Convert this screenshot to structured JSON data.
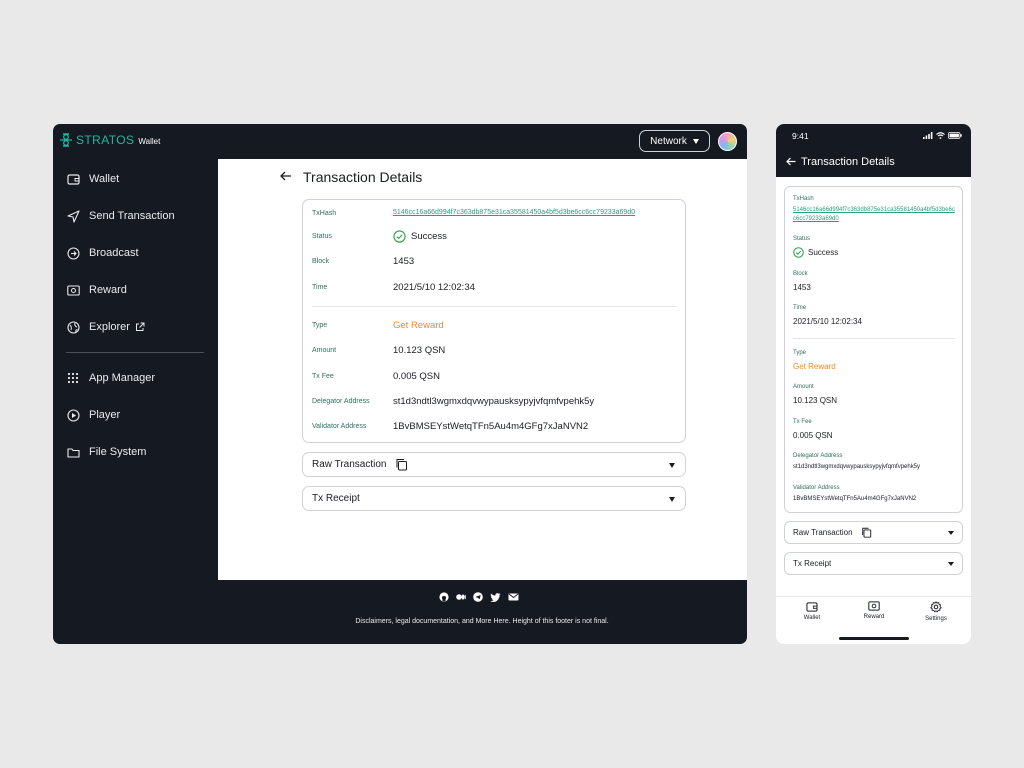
{
  "desktop": {
    "brand": {
      "name": "STRATOS",
      "sub": "Wallet"
    },
    "network_label": "Network",
    "sidebar": {
      "items": [
        {
          "label": "Wallet",
          "icon": "wallet-icon"
        },
        {
          "label": "Send Transaction",
          "icon": "send-icon"
        },
        {
          "label": "Broadcast",
          "icon": "broadcast-icon"
        },
        {
          "label": "Reward",
          "icon": "reward-icon"
        },
        {
          "label": "Explorer",
          "icon": "globe-icon"
        },
        {
          "label": "App Manager",
          "icon": "grid-icon"
        },
        {
          "label": "Player",
          "icon": "play-icon"
        },
        {
          "label": "File System",
          "icon": "folder-icon"
        }
      ]
    },
    "title": "Transaction Details",
    "details": {
      "txhash_label": "TxHash",
      "txhash": "5146cc16a66d994f7c363db875e31ca35581450a4bf5d3be6cc6cc79233a69d0",
      "status_label": "Status",
      "status": "Success",
      "block_label": "Block",
      "block": "1453",
      "time_label": "Time",
      "time": "2021/5/10 12:02:34",
      "type_label": "Type",
      "type": "Get Reward",
      "amount_label": "Amount",
      "amount": "10.123 QSN",
      "fee_label": "Tx Fee",
      "fee": "0.005 QSN",
      "delegator_label": "Delegator Address",
      "delegator": "st1d3ndtl3wgmxdqvwypausksypyjvfqmfvpehk5y",
      "validator_label": "Validator Address",
      "validator": "1BvBMSEYstWetqTFn5Au4m4GFg7xJaNVN2"
    },
    "raw_label": "Raw Transaction",
    "receipt_label": "Tx Receipt",
    "footer": {
      "socials": [
        "github-icon",
        "medium-icon",
        "telegram-icon",
        "twitter-icon",
        "mail-icon"
      ],
      "text": "Disclaimers, legal documentation, and More Here. Height of this footer is not final."
    }
  },
  "mobile": {
    "time": "9:41",
    "title": "Transaction Details",
    "details": {
      "txhash_label": "TxHash",
      "txhash": "5146cc16a66d994f7c363db875e31ca35581450a4bf5d3be6cc6cc79233a69d0",
      "status_label": "Status",
      "status": "Success",
      "block_label": "Block",
      "block": "1453",
      "time_label": "Time",
      "time": "2021/5/10 12:02:34",
      "type_label": "Type",
      "type": "Get Reward",
      "amount_label": "Amount",
      "amount": "10.123 QSN",
      "fee_label": "Tx Fee",
      "fee": "0.005 QSN",
      "delegator_label": "Delegator Address",
      "delegator": "st1d3ndtl3wgmxdqvwypausksypyjvfqmfvpehk5y",
      "validator_label": "Validator Address",
      "validator": "1BvBMSEYstWetqTFn5Au4m4GFg7xJaNVN2"
    },
    "raw_label": "Raw Transaction",
    "receipt_label": "Tx Receipt",
    "nav": [
      {
        "label": "Wallet",
        "icon": "wallet-icon"
      },
      {
        "label": "Reward",
        "icon": "reward-icon"
      },
      {
        "label": "Settings",
        "icon": "gear-icon"
      }
    ]
  },
  "colors": {
    "dark": "#151922",
    "accent": "#1fb7a0",
    "link": "#23a37d",
    "orange": "#f08a2c",
    "success": "#2a9d4a"
  }
}
